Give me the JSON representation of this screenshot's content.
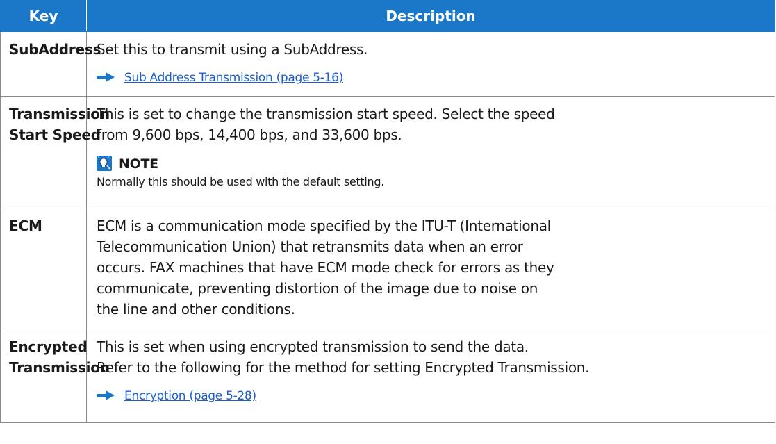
{
  "table": {
    "headers": {
      "key": "Key",
      "description": "Description"
    },
    "rows": [
      {
        "key": "SubAddress",
        "description_lines": [
          "Set this to transmit using a SubAddress."
        ],
        "reference_link": "Sub Address Transmission (page 5-16)"
      },
      {
        "key_lines": [
          "Transmission",
          "Start Speed"
        ],
        "description_lines": [
          "This is set to change the transmission start speed. Select the speed",
          "from 9,600 bps, 14,400 bps, and 33,600 bps."
        ],
        "note": {
          "label": "NOTE",
          "text": "Normally this should be used with the default setting."
        }
      },
      {
        "key": "ECM",
        "description_lines": [
          "ECM is a communication mode specified by the ITU-T (International",
          "Telecommunication Union) that retransmits data when an error",
          "occurs. FAX machines that have ECM mode check for errors as they",
          "communicate, preventing distortion of the image due to noise on",
          "the line and other conditions."
        ]
      },
      {
        "key_lines": [
          "Encrypted",
          "Transmission"
        ],
        "description_lines": [
          "This is set when using encrypted transmission to send the data.",
          "Refer to the following for the method for setting Encrypted Transmission."
        ],
        "reference_link": "Encryption (page 5-28)"
      }
    ]
  },
  "icons": {
    "reference": "arrow-right-icon",
    "note": "lightbulb-icon"
  },
  "colors": {
    "header_bg": "#1b78c8",
    "link": "#1a5fd1",
    "arrow": "#1b78c8",
    "border": "#8a8a8a"
  }
}
